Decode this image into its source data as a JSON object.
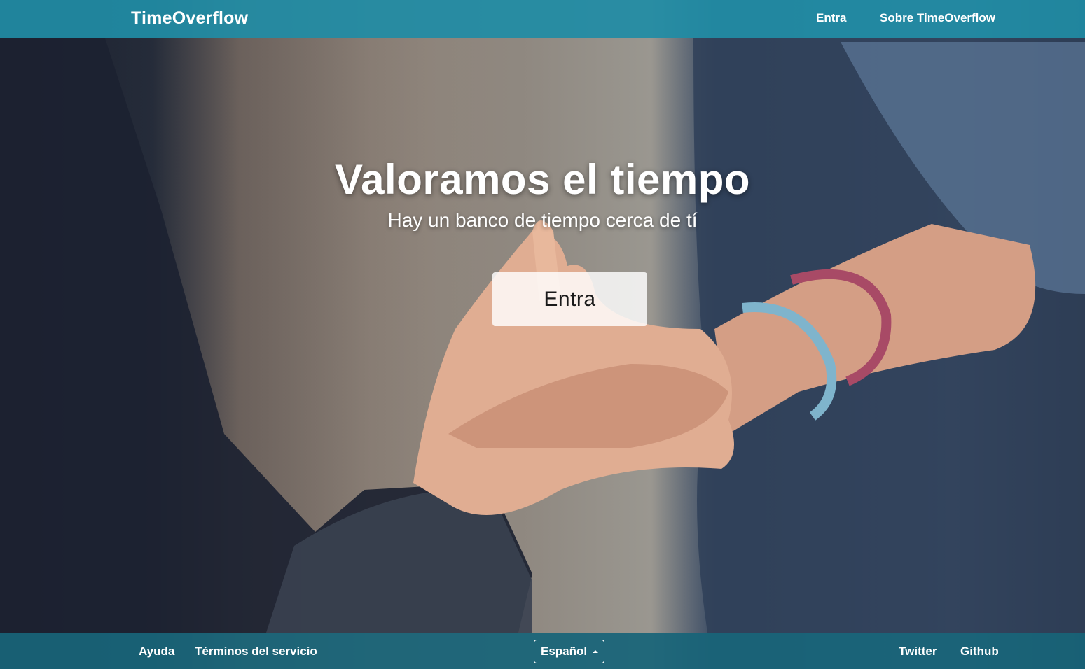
{
  "navbar": {
    "brand": "TimeOverflow",
    "links": {
      "login": "Entra",
      "about": "Sobre TimeOverflow"
    }
  },
  "hero": {
    "title": "Valoramos el tiempo",
    "subtitle": "Hay un banco de tiempo cerca de tí",
    "cta_label": "Entra"
  },
  "footer": {
    "help": "Ayuda",
    "terms": "Términos del servicio",
    "language_selected": "Español",
    "twitter": "Twitter",
    "github": "Github"
  },
  "colors": {
    "navbar_bg": "#208ca5",
    "footer_bg": "#186478",
    "text": "#ffffff"
  }
}
